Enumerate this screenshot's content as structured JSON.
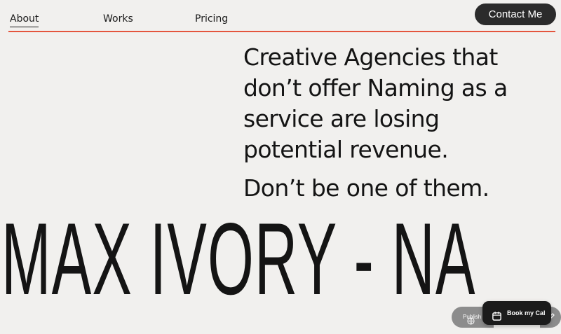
{
  "nav": {
    "items": [
      {
        "label": "About",
        "active": true
      },
      {
        "label": "Works",
        "active": false
      },
      {
        "label": "Pricing",
        "active": false
      }
    ],
    "accent_color": "#e4553d",
    "contact_label": "Contact Me"
  },
  "hero": {
    "headline_lines": [
      "Creative Agencies that",
      "don’t offer Naming as a",
      "service are losing",
      "potential revenue."
    ],
    "subhead": "Don’t be one of them.",
    "marquee_text": "MAX IVORY - NA"
  },
  "floating": {
    "publish_label": "Publish",
    "book_label": "Book my Cal",
    "publish_icon": "globe-icon",
    "edit_icon": "pencil-icon",
    "book_icon": "calendar-icon"
  },
  "colors": {
    "background": "#f1f0ee",
    "text": "#141414",
    "button_dark": "#2b2b2b"
  }
}
